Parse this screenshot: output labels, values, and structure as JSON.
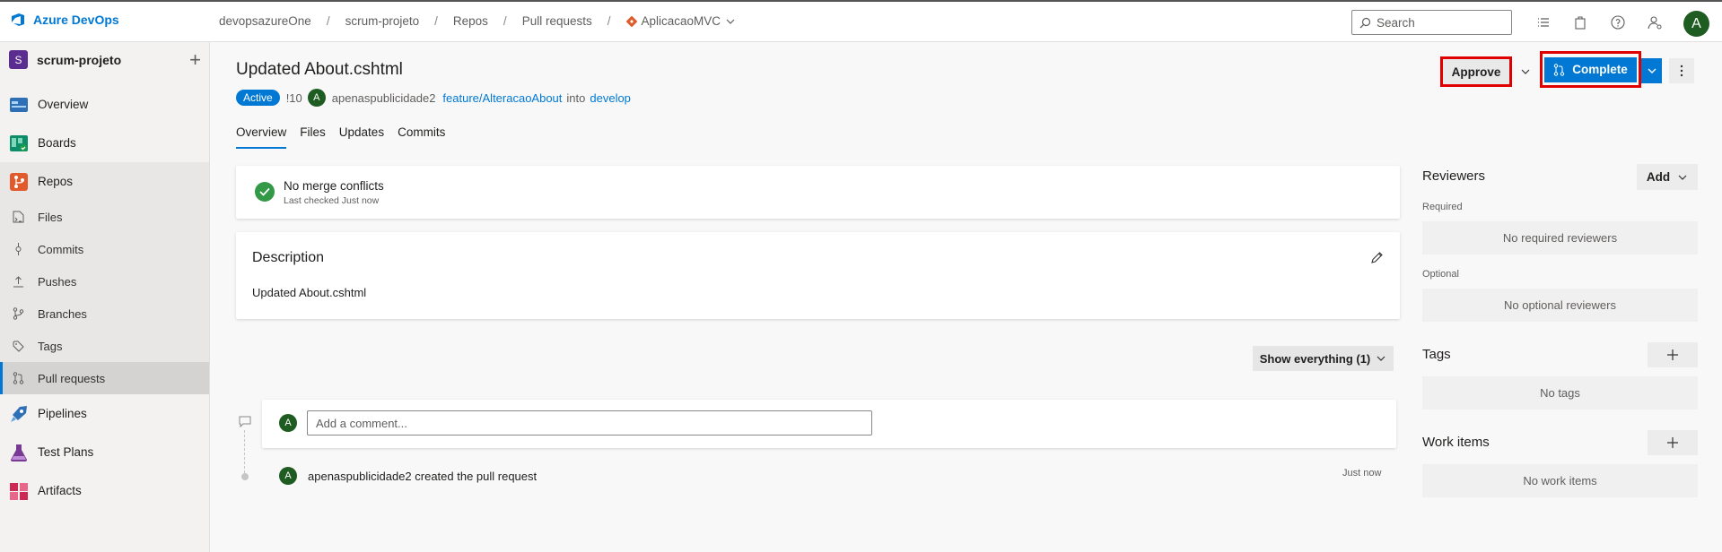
{
  "header": {
    "brand": "Azure DevOps",
    "breadcrumbs": [
      "devopsazureOne",
      "scrum-projeto",
      "Repos",
      "Pull requests"
    ],
    "repo": "AplicacaoMVC",
    "search_placeholder": "Search",
    "user_initial": "A"
  },
  "sidebar": {
    "project_initial": "S",
    "project_name": "scrum-projeto",
    "items": [
      {
        "label": "Overview",
        "icon": "overview-icon"
      },
      {
        "label": "Boards",
        "icon": "boards-icon"
      },
      {
        "label": "Repos",
        "icon": "repos-icon"
      },
      {
        "label": "Files",
        "icon": "files-icon"
      },
      {
        "label": "Commits",
        "icon": "commits-icon"
      },
      {
        "label": "Pushes",
        "icon": "pushes-icon"
      },
      {
        "label": "Branches",
        "icon": "branches-icon"
      },
      {
        "label": "Tags",
        "icon": "tags-icon"
      },
      {
        "label": "Pull requests",
        "icon": "pull-requests-icon",
        "selected": true
      },
      {
        "label": "Pipelines",
        "icon": "pipelines-icon"
      },
      {
        "label": "Test Plans",
        "icon": "test-plans-icon"
      },
      {
        "label": "Artifacts",
        "icon": "artifacts-icon"
      }
    ]
  },
  "pr": {
    "title": "Updated About.cshtml",
    "status": "Active",
    "id": "!10",
    "author_initial": "A",
    "author": "apenaspublicidade2",
    "source_branch": "feature/AlteracaoAbout",
    "into": "into",
    "target_branch": "develop",
    "approve_label": "Approve",
    "complete_label": "Complete",
    "tabs": [
      "Overview",
      "Files",
      "Updates",
      "Commits"
    ],
    "active_tab": "Overview"
  },
  "merge": {
    "title": "No merge conflicts",
    "subtitle": "Last checked Just now"
  },
  "description": {
    "title": "Description",
    "body": "Updated About.cshtml"
  },
  "activity": {
    "filter_label": "Show everything (1)",
    "comment_placeholder": "Add a comment...",
    "commenter_initial": "A",
    "event_initial": "A",
    "event_text": "apenaspublicidade2 created the pull request",
    "event_time": "Just now"
  },
  "right_panel": {
    "reviewers_title": "Reviewers",
    "add_label": "Add",
    "required_label": "Required",
    "no_required": "No required reviewers",
    "optional_label": "Optional",
    "no_optional": "No optional reviewers",
    "tags_title": "Tags",
    "no_tags": "No tags",
    "work_items_title": "Work items",
    "no_work_items": "No work items"
  },
  "colors": {
    "accent": "#0078d4",
    "active_badge": "#0078d4",
    "success": "#339947",
    "highlight_box": "#e00000"
  }
}
